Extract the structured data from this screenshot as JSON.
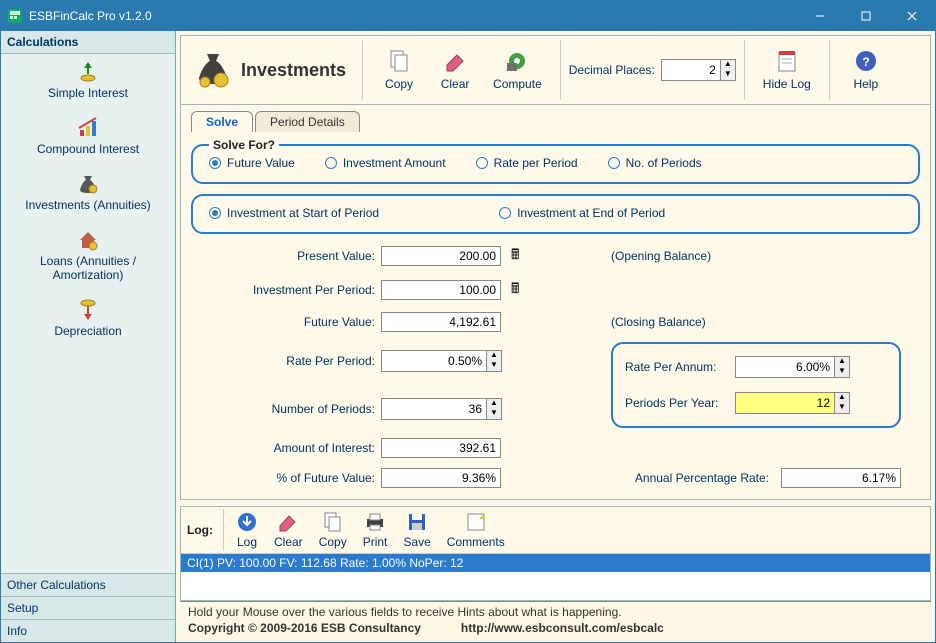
{
  "window": {
    "title": "ESBFinCalc Pro v1.2.0"
  },
  "sidebar": {
    "heading": "Calculations",
    "items": [
      {
        "label": "Simple Interest"
      },
      {
        "label": "Compound Interest"
      },
      {
        "label": "Investments (Annuities)"
      },
      {
        "label": "Loans (Annuities / Amortization)"
      },
      {
        "label": "Depreciation"
      }
    ],
    "accordion": [
      {
        "label": "Other Calculations"
      },
      {
        "label": "Setup"
      },
      {
        "label": "Info"
      }
    ]
  },
  "toolbar": {
    "page_title": "Investments",
    "copy": "Copy",
    "clear": "Clear",
    "compute": "Compute",
    "decimal_label": "Decimal Places:",
    "decimal_value": "2",
    "hide_log": "Hide Log",
    "help": "Help"
  },
  "tabs": {
    "solve": "Solve",
    "period": "Period Details"
  },
  "solve_for": {
    "legend": "Solve For?",
    "future_value": "Future Value",
    "investment_amount": "Investment Amount",
    "rate_per_period": "Rate per Period",
    "no_of_periods": "No. of Periods",
    "start": "Investment at Start of Period",
    "end": "Investment at End of Period"
  },
  "fields": {
    "present_value_label": "Present Value:",
    "present_value": "200.00",
    "opening": "(Opening Balance)",
    "inv_per_period_label": "Investment Per Period:",
    "inv_per_period": "100.00",
    "future_value_label": "Future Value:",
    "future_value": "4,192.61",
    "closing": "(Closing Balance)",
    "rate_per_period_label": "Rate Per Period:",
    "rate_per_period": "0.50%",
    "num_periods_label": "Number of Periods:",
    "num_periods": "36",
    "amount_interest_label": "Amount of Interest:",
    "amount_interest": "392.61",
    "pct_future_label": "% of Future Value:",
    "pct_future": "9.36%",
    "rate_per_annum_label": "Rate Per Annum:",
    "rate_per_annum": "6.00%",
    "periods_per_year_label": "Periods Per Year:",
    "periods_per_year": "12",
    "apr_label": "Annual Percentage Rate:",
    "apr": "6.17%"
  },
  "log": {
    "label": "Log:",
    "btn_log": "Log",
    "btn_clear": "Clear",
    "btn_copy": "Copy",
    "btn_print": "Print",
    "btn_save": "Save",
    "btn_comments": "Comments",
    "entry": "CI(1) PV: 100.00 FV: 112.68 Rate: 1.00% NoPer: 12"
  },
  "status": {
    "hint": "Hold your Mouse over the various fields to receive Hints about what is happening.",
    "copyright": "Copyright © 2009-2016 ESB Consultancy",
    "url": "http://www.esbconsult.com/esbcalc"
  }
}
